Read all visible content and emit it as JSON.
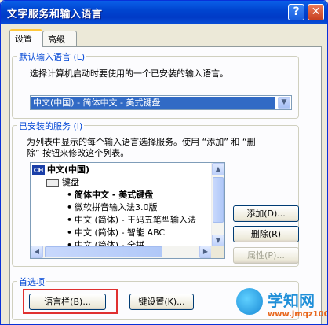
{
  "window": {
    "title": "文字服务和输入语言",
    "help_label": "?",
    "close_label": "✕"
  },
  "tabs": [
    {
      "label": "设置",
      "active": true
    },
    {
      "label": "高级",
      "active": false
    }
  ],
  "default_language": {
    "legend": "默认输入语言 (L)",
    "description": "选择计算机启动时要使用的一个已安装的输入语言。",
    "selected_value": "中文(中国) - 简体中文 - 美式键盘"
  },
  "installed_services": {
    "legend": "已安装的服务 (I)",
    "description_line1": "为列表中显示的每个输入语言选择服务。使用 “添加” 和 “删",
    "description_line2": "除” 按钮来修改这个列表。",
    "tree": {
      "language_badge": "CH",
      "language": "中文(中国)",
      "keyboard_group": "键盘",
      "items": [
        {
          "label": "简体中文 - 美式键盘",
          "bold": true
        },
        {
          "label": "微软拼音输入法3.0版",
          "bold": false
        },
        {
          "label": "中文 (简体) - 王码五笔型输入法",
          "bold": false
        },
        {
          "label": "中文 (简体) - 智能 ABC",
          "bold": false
        },
        {
          "label": "中文 (简体) - 全拼",
          "bold": false
        }
      ]
    },
    "buttons": {
      "add": "添加(D)...",
      "remove": "删除(R)",
      "properties": "属性(P)..."
    }
  },
  "preferences": {
    "legend": "首选项",
    "language_bar_button": "语言栏(B)...",
    "key_settings_button": "键设置(K)..."
  },
  "watermark": {
    "title": "学知网",
    "url": "www.jmqz1000.com"
  },
  "colors": {
    "title_bar": "#0045d0",
    "selection": "#316ac5",
    "highlight_box": "#e03030",
    "legend_text": "#0046d5"
  }
}
